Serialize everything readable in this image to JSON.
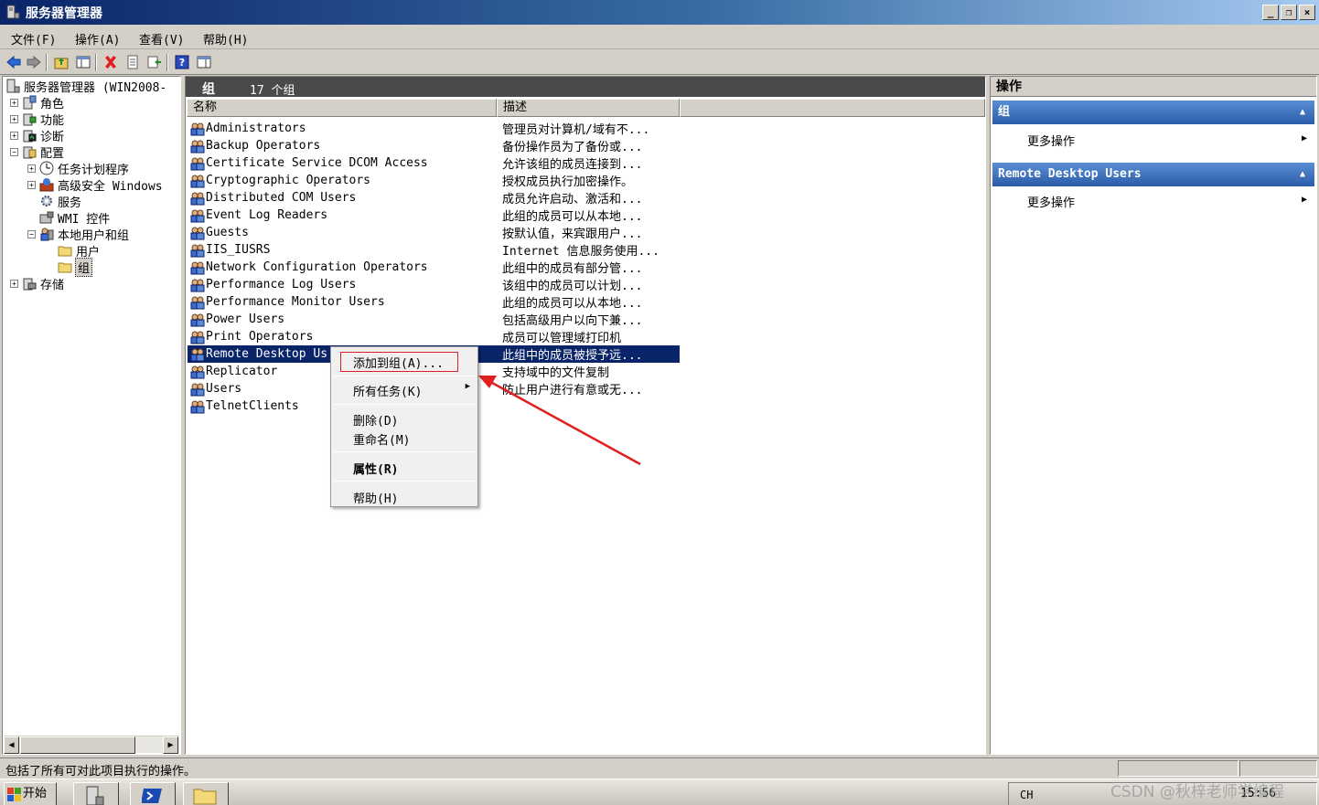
{
  "window": {
    "title": "服务器管理器",
    "controls": {
      "minimize": "_",
      "restore": "❐",
      "close": "×"
    }
  },
  "menu": [
    "文件(F)",
    "操作(A)",
    "查看(V)",
    "帮助(H)"
  ],
  "tree": {
    "items": [
      {
        "label": "服务器管理器 (WIN2008-",
        "expander": "",
        "icon": "server-manager-icon"
      },
      {
        "label": "角色",
        "expander": "+",
        "icon": "roles-icon"
      },
      {
        "label": "功能",
        "expander": "+",
        "icon": "features-icon"
      },
      {
        "label": "诊断",
        "expander": "+",
        "icon": "diagnostics-icon"
      },
      {
        "label": "配置",
        "expander": "−",
        "icon": "configuration-icon"
      },
      {
        "label": "任务计划程序",
        "expander": "+",
        "icon": "clock-icon"
      },
      {
        "label": "高级安全 Windows",
        "expander": "+",
        "icon": "firewall-icon"
      },
      {
        "label": "服务",
        "expander": "",
        "icon": "gear-icon"
      },
      {
        "label": "WMI 控件",
        "expander": "",
        "icon": "wmi-icon"
      },
      {
        "label": "本地用户和组",
        "expander": "−",
        "icon": "users-groups-icon"
      },
      {
        "label": "用户",
        "expander": "",
        "icon": "folder-icon"
      },
      {
        "label": "组",
        "expander": "",
        "icon": "folder-icon"
      },
      {
        "label": "存储",
        "expander": "+",
        "icon": "storage-icon"
      }
    ]
  },
  "main": {
    "header_title": "组",
    "header_count": "17 个组",
    "columns": {
      "name": "名称",
      "description": "描述"
    },
    "rows": [
      {
        "name": "Administrators",
        "description": "管理员对计算机/域有不..."
      },
      {
        "name": "Backup Operators",
        "description": "备份操作员为了备份或..."
      },
      {
        "name": "Certificate Service DCOM Access",
        "description": "允许该组的成员连接到..."
      },
      {
        "name": "Cryptographic Operators",
        "description": "授权成员执行加密操作。"
      },
      {
        "name": "Distributed COM Users",
        "description": "成员允许启动、激活和..."
      },
      {
        "name": "Event Log Readers",
        "description": "此组的成员可以从本地..."
      },
      {
        "name": "Guests",
        "description": "按默认值，来宾跟用户..."
      },
      {
        "name": "IIS_IUSRS",
        "description": "Internet 信息服务使用..."
      },
      {
        "name": "Network Configuration Operators",
        "description": "此组中的成员有部分管..."
      },
      {
        "name": "Performance Log Users",
        "description": "该组中的成员可以计划..."
      },
      {
        "name": "Performance Monitor Users",
        "description": "此组的成员可以从本地..."
      },
      {
        "name": "Power Users",
        "description": "包括高级用户以向下兼..."
      },
      {
        "name": "Print Operators",
        "description": "成员可以管理域打印机"
      },
      {
        "name": "Remote Desktop Us",
        "description": "此组中的成员被授予远..."
      },
      {
        "name": "Replicator",
        "description": "支持域中的文件复制"
      },
      {
        "name": "Users",
        "description": "防止用户进行有意或无..."
      },
      {
        "name": "TelnetClients",
        "description": ""
      }
    ]
  },
  "context_menu": {
    "add_to_group": "添加到组(A)...",
    "all_tasks": "所有任务(K)",
    "delete": "删除(D)",
    "rename": "重命名(M)",
    "properties": "属性(R)",
    "help": "帮助(H)"
  },
  "actions": {
    "title": "操作",
    "sections": [
      {
        "title": "组",
        "item": "更多操作"
      },
      {
        "title": "Remote Desktop Users",
        "item": "更多操作"
      }
    ]
  },
  "status": {
    "text": "包括了所有可对此项目执行的操作。"
  },
  "taskbar": {
    "start": "开始",
    "lang": "CH",
    "time": "15:56"
  },
  "watermark": "CSDN @秋梓老师学编程",
  "colors": {
    "selection": "#0a246a",
    "annotation": "#e02020",
    "action_header": "#2a5ca8"
  }
}
